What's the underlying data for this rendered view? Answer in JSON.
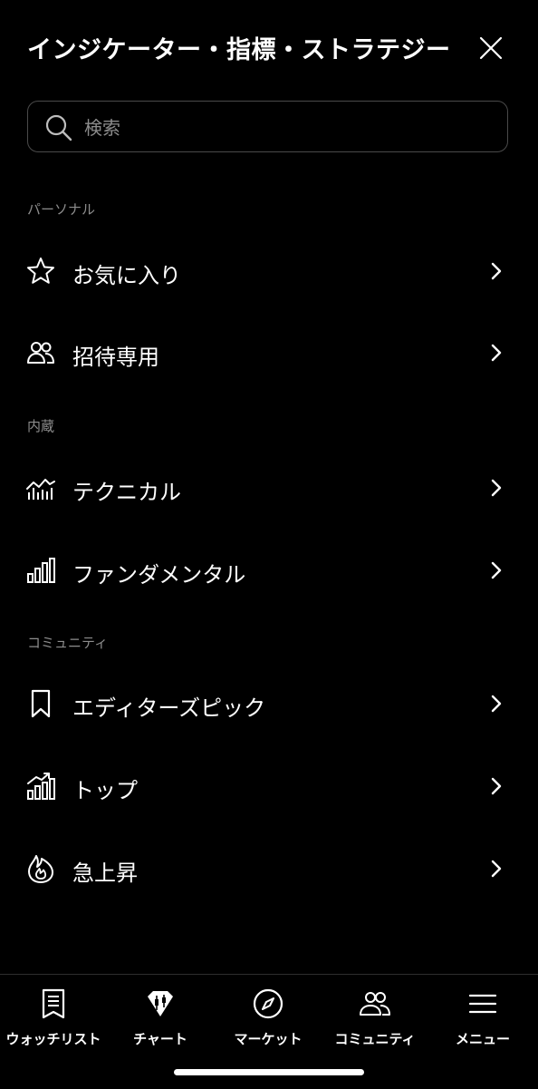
{
  "header": {
    "title": "インジケーター・指標・ストラテジー"
  },
  "search": {
    "placeholder": "検索",
    "value": ""
  },
  "sections": {
    "personal": {
      "label": "パーソナル",
      "items": [
        {
          "label": "お気に入り",
          "icon": "star-icon"
        },
        {
          "label": "招待専用",
          "icon": "users-icon"
        }
      ]
    },
    "builtin": {
      "label": "内蔵",
      "items": [
        {
          "label": "テクニカル",
          "icon": "technical-chart-icon"
        },
        {
          "label": "ファンダメンタル",
          "icon": "bar-chart-icon"
        }
      ]
    },
    "community": {
      "label": "コミュニティ",
      "items": [
        {
          "label": "エディターズピック",
          "icon": "bookmark-icon"
        },
        {
          "label": "トップ",
          "icon": "trending-bars-icon"
        },
        {
          "label": "急上昇",
          "icon": "flame-icon"
        }
      ]
    }
  },
  "tabbar": {
    "tabs": [
      {
        "label": "ウォッチリスト",
        "icon": "watchlist-icon"
      },
      {
        "label": "チャート",
        "icon": "chart-candles-icon"
      },
      {
        "label": "マーケット",
        "icon": "compass-icon"
      },
      {
        "label": "コミュニティ",
        "icon": "community-icon"
      },
      {
        "label": "メニュー",
        "icon": "menu-icon"
      }
    ]
  },
  "colors": {
    "background": "#000000",
    "text": "#ffffff",
    "secondary_text": "#8d8d8d",
    "border": "#4a4a4a"
  }
}
